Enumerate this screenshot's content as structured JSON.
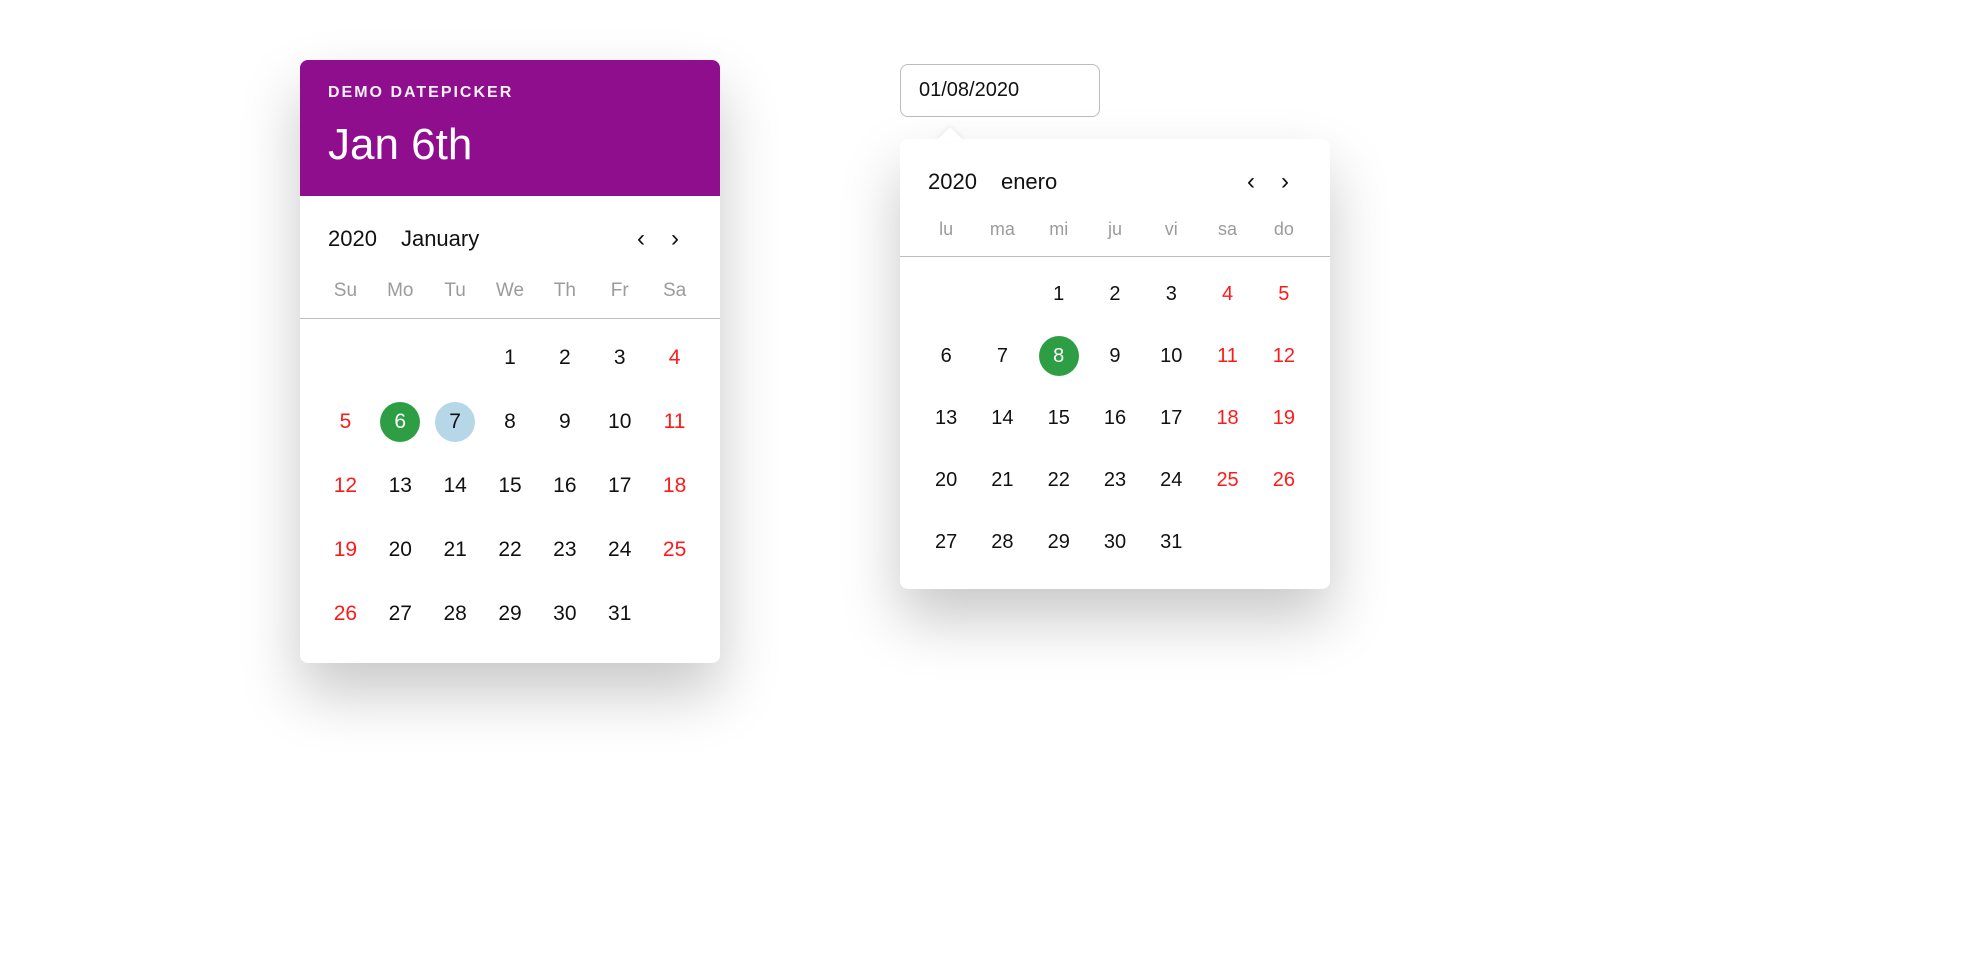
{
  "colors": {
    "accent_purple": "#8e0e8e",
    "selected_green": "#2e9e44",
    "today_blue": "#b5d7e8",
    "holiday_red": "#ff1a1a"
  },
  "left": {
    "eyebrow": "DEMO DATEPICKER",
    "title": "Jan 6th",
    "year": "2020",
    "month": "January",
    "dow": [
      "Su",
      "Mo",
      "Tu",
      "We",
      "Th",
      "Fr",
      "Sa"
    ],
    "weeks": [
      [
        {
          "n": "",
          "cls": "blank"
        },
        {
          "n": "",
          "cls": "blank"
        },
        {
          "n": "",
          "cls": "blank"
        },
        {
          "n": "1",
          "cls": ""
        },
        {
          "n": "2",
          "cls": ""
        },
        {
          "n": "3",
          "cls": ""
        },
        {
          "n": "4",
          "cls": "red"
        }
      ],
      [
        {
          "n": "5",
          "cls": "red"
        },
        {
          "n": "6",
          "cls": "selected"
        },
        {
          "n": "7",
          "cls": "today"
        },
        {
          "n": "8",
          "cls": ""
        },
        {
          "n": "9",
          "cls": ""
        },
        {
          "n": "10",
          "cls": ""
        },
        {
          "n": "11",
          "cls": "red"
        }
      ],
      [
        {
          "n": "12",
          "cls": "red"
        },
        {
          "n": "13",
          "cls": ""
        },
        {
          "n": "14",
          "cls": ""
        },
        {
          "n": "15",
          "cls": ""
        },
        {
          "n": "16",
          "cls": ""
        },
        {
          "n": "17",
          "cls": ""
        },
        {
          "n": "18",
          "cls": "red"
        }
      ],
      [
        {
          "n": "19",
          "cls": "red"
        },
        {
          "n": "20",
          "cls": ""
        },
        {
          "n": "21",
          "cls": ""
        },
        {
          "n": "22",
          "cls": ""
        },
        {
          "n": "23",
          "cls": ""
        },
        {
          "n": "24",
          "cls": ""
        },
        {
          "n": "25",
          "cls": "red"
        }
      ],
      [
        {
          "n": "26",
          "cls": "red"
        },
        {
          "n": "27",
          "cls": ""
        },
        {
          "n": "28",
          "cls": ""
        },
        {
          "n": "29",
          "cls": ""
        },
        {
          "n": "30",
          "cls": ""
        },
        {
          "n": "31",
          "cls": ""
        },
        {
          "n": "",
          "cls": "blank"
        }
      ]
    ]
  },
  "right": {
    "input_value": "01/08/2020",
    "year": "2020",
    "month": "enero",
    "dow": [
      "lu",
      "ma",
      "mi",
      "ju",
      "vi",
      "sa",
      "do"
    ],
    "weeks": [
      [
        {
          "n": "",
          "cls": "blank"
        },
        {
          "n": "",
          "cls": "blank"
        },
        {
          "n": "1",
          "cls": ""
        },
        {
          "n": "2",
          "cls": ""
        },
        {
          "n": "3",
          "cls": ""
        },
        {
          "n": "4",
          "cls": "red"
        },
        {
          "n": "5",
          "cls": "red"
        }
      ],
      [
        {
          "n": "6",
          "cls": ""
        },
        {
          "n": "7",
          "cls": ""
        },
        {
          "n": "8",
          "cls": "selected"
        },
        {
          "n": "9",
          "cls": ""
        },
        {
          "n": "10",
          "cls": ""
        },
        {
          "n": "11",
          "cls": "red"
        },
        {
          "n": "12",
          "cls": "red"
        }
      ],
      [
        {
          "n": "13",
          "cls": ""
        },
        {
          "n": "14",
          "cls": ""
        },
        {
          "n": "15",
          "cls": ""
        },
        {
          "n": "16",
          "cls": ""
        },
        {
          "n": "17",
          "cls": ""
        },
        {
          "n": "18",
          "cls": "red"
        },
        {
          "n": "19",
          "cls": "red"
        }
      ],
      [
        {
          "n": "20",
          "cls": ""
        },
        {
          "n": "21",
          "cls": ""
        },
        {
          "n": "22",
          "cls": ""
        },
        {
          "n": "23",
          "cls": ""
        },
        {
          "n": "24",
          "cls": ""
        },
        {
          "n": "25",
          "cls": "red"
        },
        {
          "n": "26",
          "cls": "red"
        }
      ],
      [
        {
          "n": "27",
          "cls": ""
        },
        {
          "n": "28",
          "cls": ""
        },
        {
          "n": "29",
          "cls": ""
        },
        {
          "n": "30",
          "cls": ""
        },
        {
          "n": "31",
          "cls": ""
        },
        {
          "n": "",
          "cls": "blank"
        },
        {
          "n": "",
          "cls": "blank"
        }
      ]
    ]
  }
}
